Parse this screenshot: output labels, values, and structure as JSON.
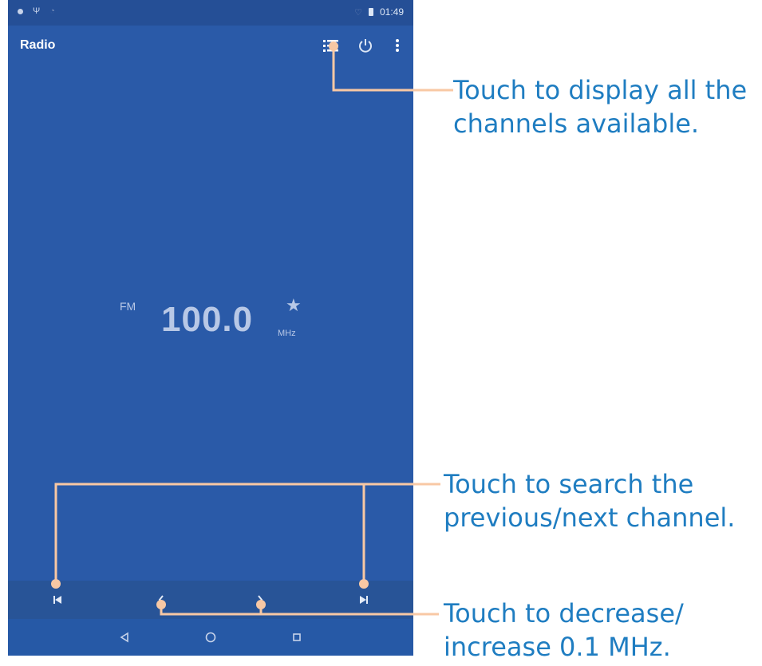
{
  "status_bar": {
    "time": "01:49"
  },
  "app_bar": {
    "title": "Radio",
    "icons": [
      "channel-list-icon",
      "power-icon",
      "more-vert-icon"
    ]
  },
  "tuner": {
    "band": "FM",
    "frequency": "100.0",
    "unit": "MHz",
    "favorite_icon": "star-icon"
  },
  "controls": [
    "previous-channel-icon",
    "decrease-icon",
    "increase-icon",
    "next-channel-icon"
  ],
  "nav_bar": [
    "back-icon",
    "home-icon",
    "recents-icon"
  ],
  "callouts": {
    "channels": {
      "line1": "Touch to display all the",
      "line2": "channels available."
    },
    "search": {
      "line1": "Touch to search the",
      "line2": "previous/next channel."
    },
    "tune": {
      "line1": "Touch to decrease/",
      "line2": "increase 0.1 MHz."
    }
  },
  "colors": {
    "screen": "#2a5aa8",
    "callout_line": "#f8c8a4",
    "callout_text": "#1f7dc1"
  }
}
